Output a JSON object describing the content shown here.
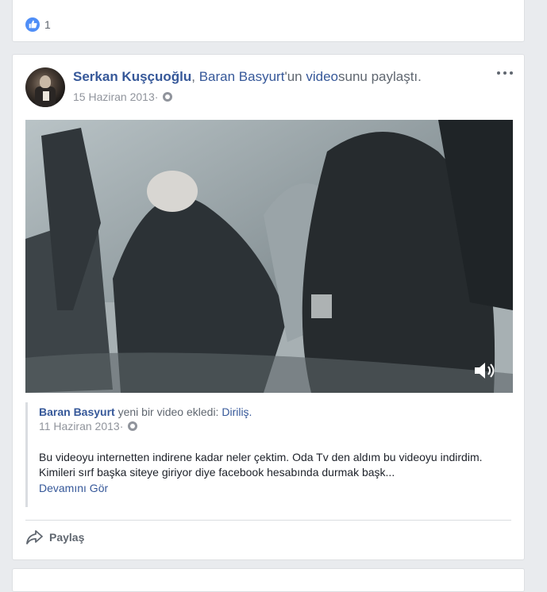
{
  "previous_post": {
    "reaction_count": "1"
  },
  "post": {
    "actor": "Serkan Kuşçuoğlu",
    "sep": ", ",
    "shared_from": "Baran Basyurt",
    "possessive": "'un ",
    "video_word": "video",
    "action_suffix": "sunu paylaştı.",
    "date": "15 Haziran 2013",
    "date_sep": " · ",
    "shared": {
      "actor": "Baran Basyurt",
      "action": " yeni bir video ekledi: ",
      "title": "Diriliş.",
      "date": "11 Haziran 2013",
      "date_sep": " · ",
      "text": "Bu videoyu internetten indirene kadar neler çektim. Oda Tv den aldım bu videoyu indirdim. Kimileri sırf başka siteye giriyor diye facebook hesabında durmak başk...",
      "see_more": "Devamını Gör"
    },
    "share_label": "Paylaş"
  },
  "colors": {
    "link": "#365899",
    "meta": "#90949c",
    "like": "#4f8ef7",
    "background": "#e9ebee"
  }
}
